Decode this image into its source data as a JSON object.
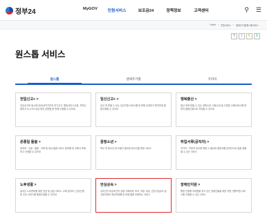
{
  "header": {
    "logo": "정부24",
    "nav": [
      "MyGOV",
      "민원서비스",
      "보조금24",
      "정책정보",
      "고객센터"
    ],
    "active_nav_index": 1
  },
  "breadcrumb": [
    "Home",
    "민원서비스",
    "생애주기별/원스톱서비스"
  ],
  "share_icons": [
    "facebook-icon",
    "twitter-icon",
    "kakaostory-icon",
    "blog-icon"
  ],
  "page_title": "원스톱 서비스",
  "tabs": [
    "원스톱",
    "생애주기별",
    "꾸러미"
  ],
  "active_tab_index": 0,
  "cards": [
    {
      "title": "전입신고+ >",
      "desc": "전입신고와 동시에 공공/공익기관의 전기신고, 행정서비스신청, 지역신청하고 도시가스요금 등의 감면을 한 번에 신청할 수 있어요"
    },
    {
      "title": "임신신고+ >",
      "desc": "임신 후 받을 수 있는 임신지원 서비스를 한 번에 안내받고 편리하게 통합신청할 수 있어요"
    },
    {
      "title": "행복출산 >",
      "desc": "출산 후에 받을 수 있는 양육수당, 아동수당 등 다양한 수혜서비스를 한 번의 통합신청으로 처리할 수 있어요"
    },
    {
      "title": "온종일 돌봄 >",
      "desc": "방과후 · 주말 · 돌봄 · 교육 등 대상 돌봄 서비스 정보를 한 곳에서 조회하고 신청할 수 있어요"
    },
    {
      "title": "꿈청소년 >",
      "desc": "학교 밖 청소년 등 도움이 필요한 청소년을 위한 서비스"
    },
    {
      "title": "취업서류(공직자) >",
      "desc": "국가직 · 지방직 공무원 채용 시 필요한 증명서를 온라인으로 일괄 제출할 수 있는 서비스"
    },
    {
      "title": "노후생활 >",
      "desc": "늘어난 노후준비를 위한 연금 및 상담 서비스, 교육 일자리, 건강/산정 등 주요 서비스를 통합신청할 수 있어요"
    },
    {
      "title": "안심상속 >",
      "desc": "상속인이 피상속인의 금융 거래내역, 토지, 차량, 세금, 연금가입유무 등 사망자정보 재산조회를 한 번에 통합 조회하는 서비스"
    },
    {
      "title": "장애인지원 >",
      "desc": "행정 신청에 어려움을 겪고 있는 장애인들을 위한 지원, 생활지원 서비스를 신청할 수 있는 서비스"
    }
  ],
  "highlighted_card_index": 7
}
